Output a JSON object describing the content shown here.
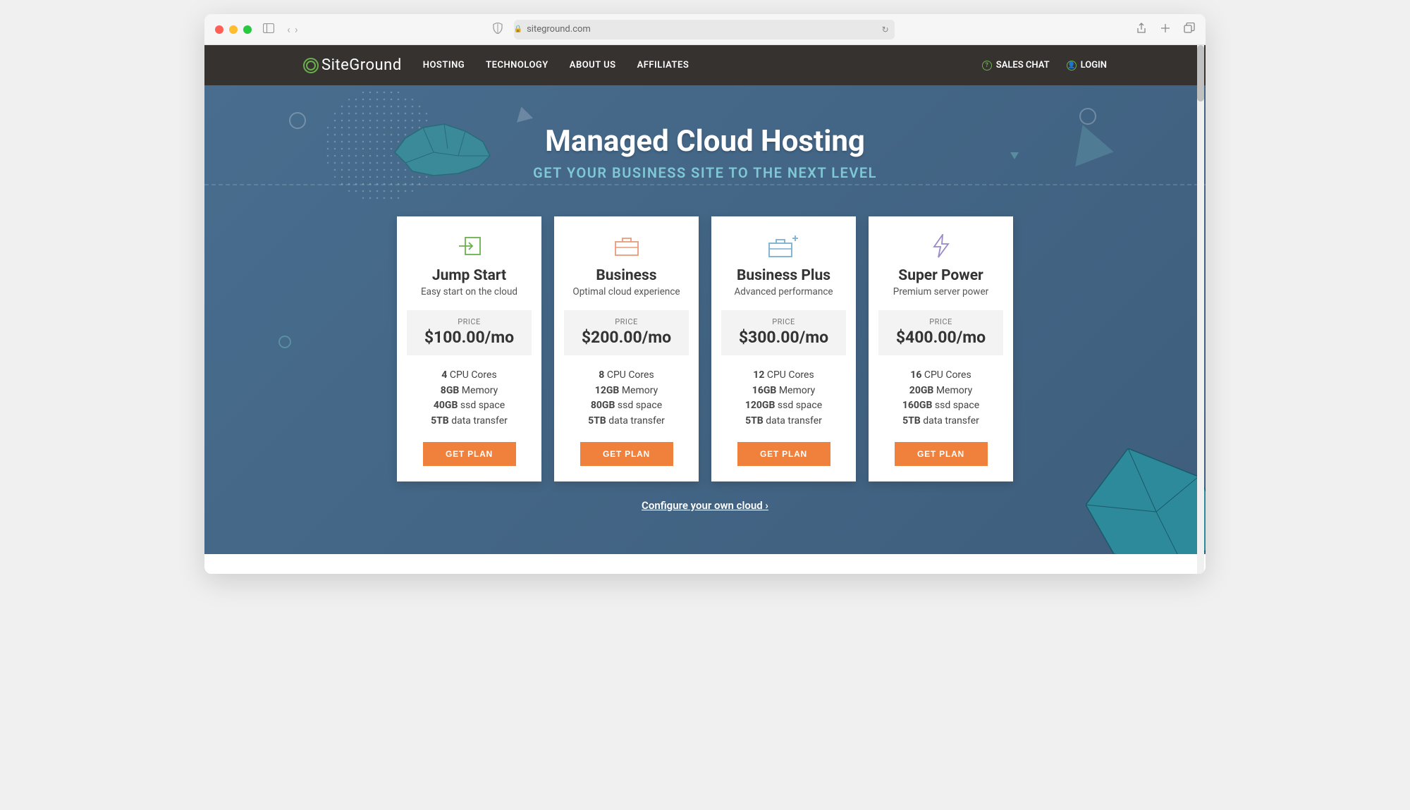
{
  "browser": {
    "url": "siteground.com"
  },
  "header": {
    "brand": "SiteGround",
    "nav": [
      "HOSTING",
      "TECHNOLOGY",
      "ABOUT US",
      "AFFILIATES"
    ],
    "sales_chat": "SALES CHAT",
    "login": "LOGIN"
  },
  "hero": {
    "title": "Managed Cloud Hosting",
    "subtitle": "GET YOUR BUSINESS SITE TO THE NEXT LEVEL",
    "configure_link": "Configure your own cloud"
  },
  "plans": [
    {
      "name": "Jump Start",
      "tagline": "Easy start on the cloud",
      "price_label": "PRICE",
      "price": "$100.00/mo",
      "cpu_val": "4",
      "cpu_lbl": "CPU Cores",
      "mem_val": "8GB",
      "mem_lbl": "Memory",
      "ssd_val": "40GB",
      "ssd_lbl": "ssd space",
      "trn_val": "5TB",
      "trn_lbl": "data transfer",
      "cta": "GET PLAN"
    },
    {
      "name": "Business",
      "tagline": "Optimal cloud experience",
      "price_label": "PRICE",
      "price": "$200.00/mo",
      "cpu_val": "8",
      "cpu_lbl": "CPU Cores",
      "mem_val": "12GB",
      "mem_lbl": "Memory",
      "ssd_val": "80GB",
      "ssd_lbl": "ssd space",
      "trn_val": "5TB",
      "trn_lbl": "data transfer",
      "cta": "GET PLAN"
    },
    {
      "name": "Business Plus",
      "tagline": "Advanced performance",
      "price_label": "PRICE",
      "price": "$300.00/mo",
      "cpu_val": "12",
      "cpu_lbl": "CPU Cores",
      "mem_val": "16GB",
      "mem_lbl": "Memory",
      "ssd_val": "120GB",
      "ssd_lbl": "ssd space",
      "trn_val": "5TB",
      "trn_lbl": "data transfer",
      "cta": "GET PLAN"
    },
    {
      "name": "Super Power",
      "tagline": "Premium server power",
      "price_label": "PRICE",
      "price": "$400.00/mo",
      "cpu_val": "16",
      "cpu_lbl": "CPU Cores",
      "mem_val": "20GB",
      "mem_lbl": "Memory",
      "ssd_val": "160GB",
      "ssd_lbl": "ssd space",
      "trn_val": "5TB",
      "trn_lbl": "data transfer",
      "cta": "GET PLAN"
    }
  ]
}
